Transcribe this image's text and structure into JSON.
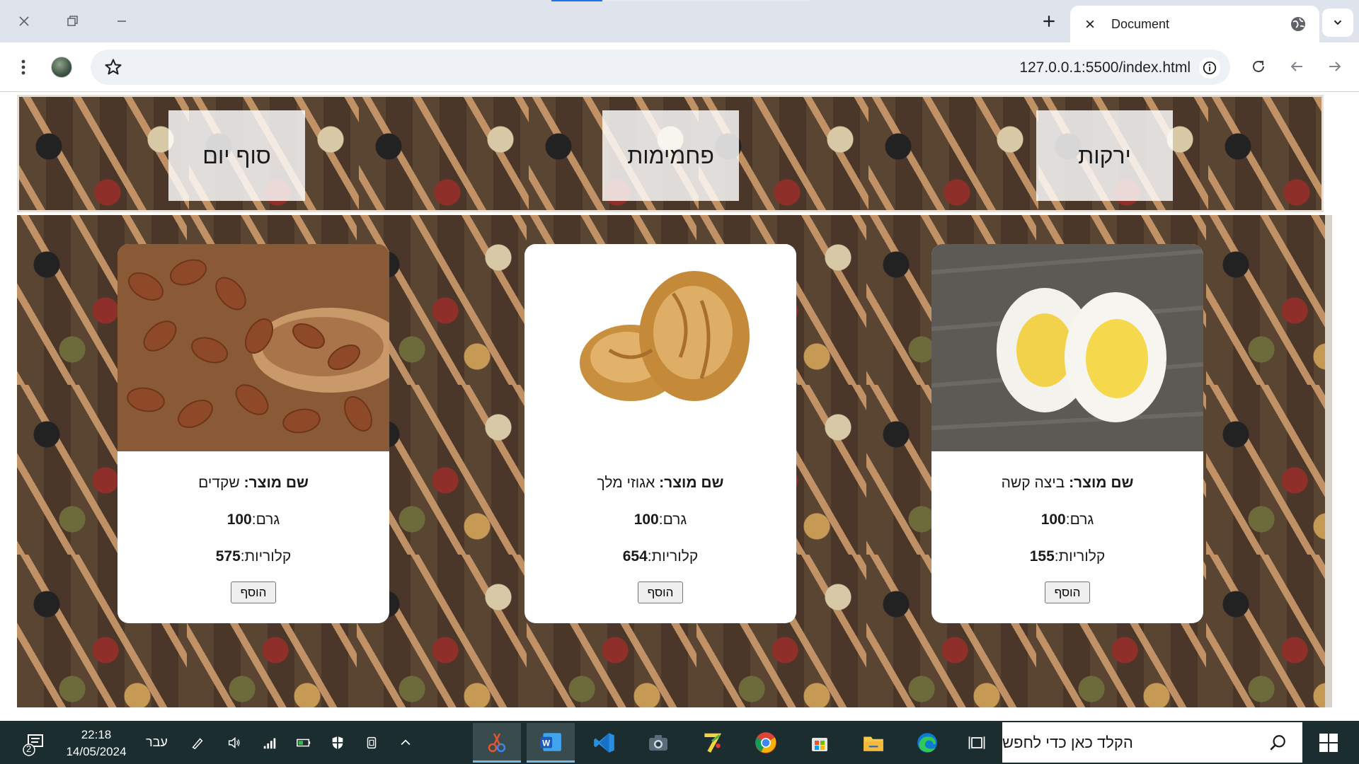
{
  "browser": {
    "tab_title": "Document",
    "url": "127.0.0.1:5500/index.html"
  },
  "nav": {
    "items": [
      {
        "label": "ירקות"
      },
      {
        "label": "פחמימות"
      },
      {
        "label": "סוף יום"
      }
    ]
  },
  "products": [
    {
      "name_prefix": "שם מוצר:",
      "name": "ביצה קשה",
      "grams_label": "גרם:",
      "grams": "100",
      "calories_label": "קלוריות:",
      "calories": "155",
      "add_label": "הוסף",
      "image": "hard-boiled-egg"
    },
    {
      "name_prefix": "שם מוצר:",
      "name": "אגוזי מלך",
      "grams_label": "גרם:",
      "grams": "100",
      "calories_label": "קלוריות:",
      "calories": "654",
      "add_label": "הוסף",
      "image": "walnuts"
    },
    {
      "name_prefix": "שם מוצר:",
      "name": "שקדים",
      "grams_label": "גרם:",
      "grams": "100",
      "calories_label": "קלוריות:",
      "calories": "575",
      "add_label": "הוסף",
      "image": "almonds"
    }
  ],
  "taskbar": {
    "time": "22:18",
    "date": "14/05/2024",
    "language": "עבר",
    "notification_count": "2",
    "search_placeholder": "הקלד כאן כדי לחפש",
    "apps": [
      "snipping-tool",
      "word",
      "vscode",
      "camera",
      "paint-app",
      "chrome",
      "store",
      "file-explorer",
      "edge",
      "task-view"
    ]
  },
  "colors": {
    "accent": "#1a73e8",
    "chrome_tab_bar": "#dfe3eb",
    "taskbar": "#1b2d2f"
  }
}
